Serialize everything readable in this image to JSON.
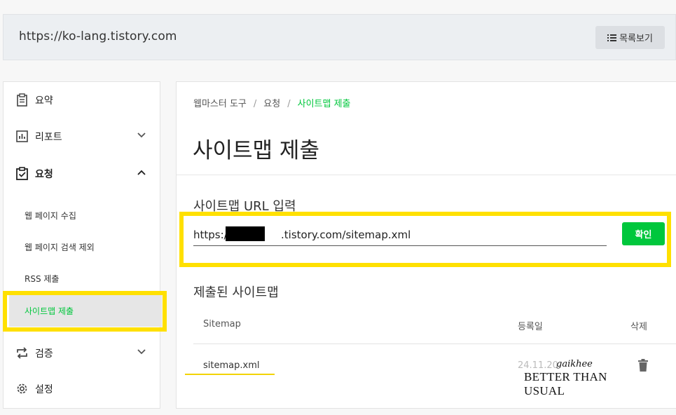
{
  "header": {
    "site_url": "https://ko-lang.tistory.com",
    "list_button_label": "목록보기"
  },
  "sidebar": {
    "items": [
      {
        "label": "요약",
        "icon": "clipboard-icon"
      },
      {
        "label": "리포트",
        "icon": "bar-chart-icon"
      },
      {
        "label": "요청",
        "icon": "clipboard-check-icon"
      },
      {
        "label": "검증",
        "icon": "swap-arrows-icon"
      },
      {
        "label": "설정",
        "icon": "gear-icon"
      }
    ],
    "sub_items": [
      "웹 페이지 수집",
      "웹 페이지 검색 제외",
      "RSS 제출",
      "사이트맵 제출"
    ]
  },
  "main": {
    "breadcrumb": [
      "웹마스터 도구",
      "요청",
      "사이트맵 제출"
    ],
    "title": "사이트맵 제출",
    "url_section_title": "사이트맵 URL 입력",
    "url_value": "https:/                .tistory.com/sitemap.xml",
    "confirm_label": "확인",
    "submitted_title": "제출된 사이트맵",
    "table": {
      "headers": [
        "Sitemap",
        "등록일",
        "삭제"
      ],
      "rows": [
        {
          "sitemap": "sitemap.xml",
          "date": "24.11.20"
        }
      ]
    },
    "watermark": {
      "script": "gaikhee",
      "text": "BETTER THAN USUAL"
    }
  },
  "colors": {
    "accent": "#00c73c",
    "highlight": "#ffe000"
  }
}
